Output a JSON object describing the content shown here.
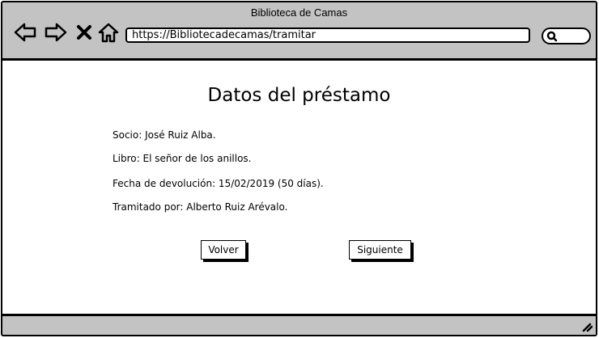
{
  "window": {
    "title": "Biblioteca de Camas"
  },
  "toolbar": {
    "back_icon": "arrow-left-icon",
    "forward_icon": "arrow-right-icon",
    "stop_icon": "close-icon",
    "home_icon": "home-icon",
    "search_icon": "search-icon"
  },
  "address_bar": {
    "url": "https://Bibliotecadecamas/tramitar"
  },
  "page": {
    "title": "Datos del préstamo",
    "details": {
      "socio": "Socio: José Ruiz Alba.",
      "libro": "Libro: El señor de los anillos.",
      "fecha": "Fecha de devolución: 15/02/2019 (50 días).",
      "tramitado": "Tramitado por: Alberto Ruiz Arévalo."
    },
    "buttons": {
      "volver": "Volver",
      "siguiente": "Siguiente"
    }
  },
  "colors": {
    "chrome_background": "#c3c3c3",
    "page_background": "#ffffff",
    "stroke": "#000000"
  }
}
